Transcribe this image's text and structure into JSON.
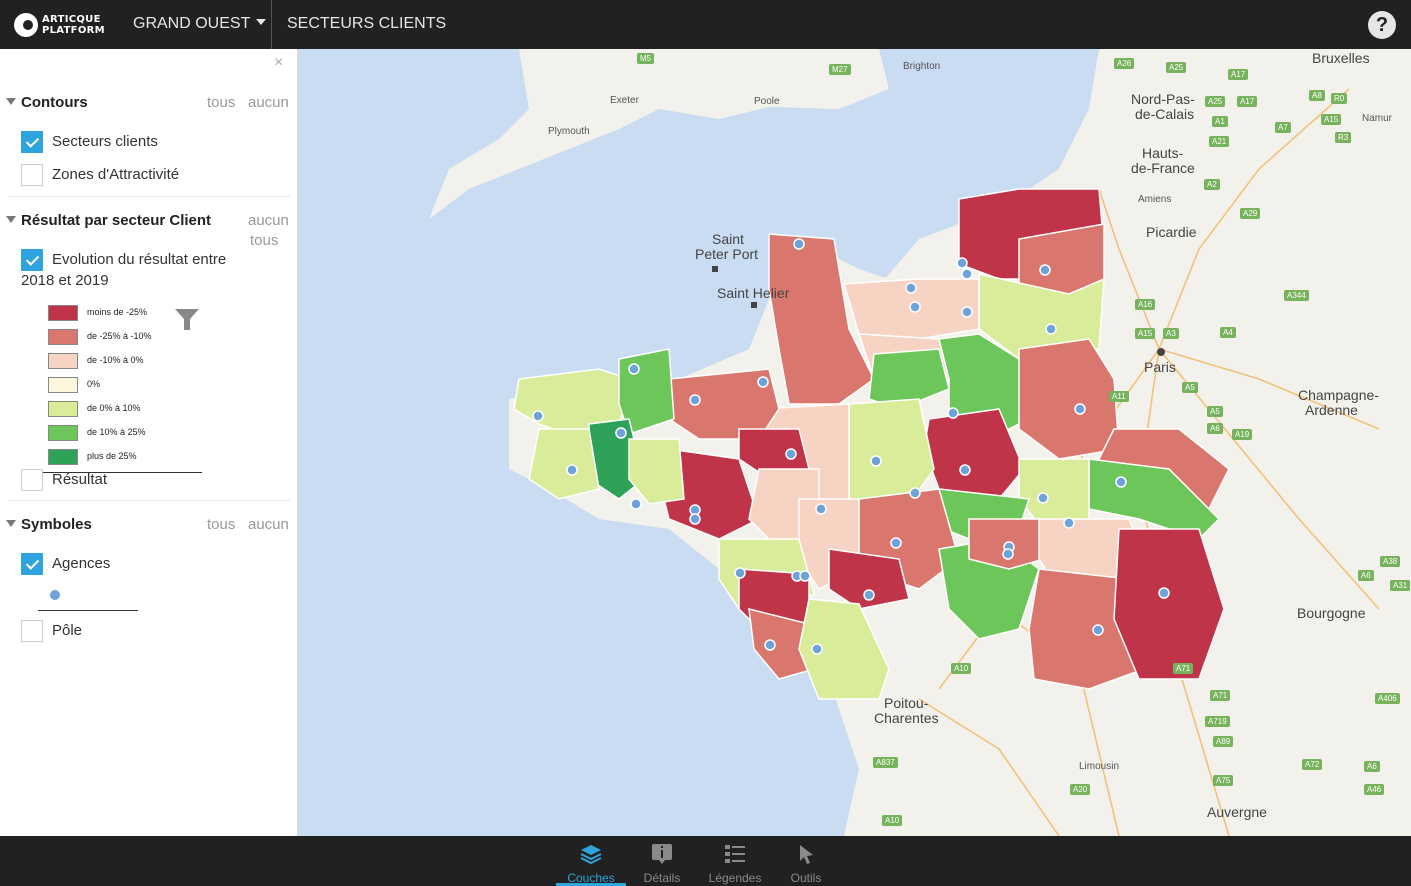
{
  "app": {
    "logo_line1": "ARTICQUE",
    "logo_line2": "PLATFORM",
    "region": "GRAND OUEST",
    "title": "SECTEURS CLIENTS",
    "help_label": "?"
  },
  "sidebar": {
    "close_label": "×",
    "contours": {
      "title": "Contours",
      "all_label": "tous",
      "none_label": "aucun",
      "items": [
        {
          "label": "Secteurs clients",
          "checked": true
        },
        {
          "label": "Zones d'Attractivité",
          "checked": false
        }
      ]
    },
    "resultat": {
      "title": "Résultat par secteur Client",
      "none_label": "aucun",
      "all_label": "tous",
      "layer_label_line1": "Evolution du résultat entre",
      "layer_label_line2": "2018 et 2019",
      "legend": [
        {
          "label": "moins de -25%",
          "color": "#c0344a"
        },
        {
          "label": "de -25% à -10%",
          "color": "#d9766d"
        },
        {
          "label": "de -10% à 0%",
          "color": "#f6d3c3"
        },
        {
          "label": "0%",
          "color": "#fbf6dc"
        },
        {
          "label": "de 0% à 10%",
          "color": "#d9ec9a"
        },
        {
          "label": "de 10% à 25%",
          "color": "#6cc65a"
        },
        {
          "label": "plus de 25%",
          "color": "#2fa25a"
        }
      ],
      "second_item": "Résultat"
    },
    "symboles": {
      "title": "Symboles",
      "all_label": "tous",
      "none_label": "aucun",
      "items": [
        {
          "label": "Agences",
          "checked": true
        },
        {
          "label": "Pôle",
          "checked": false
        }
      ],
      "agency_color": "#6ea3d9"
    }
  },
  "map": {
    "cities": [
      "Bruxelles",
      "Nord-Pas-",
      "de-Calais",
      "Hauts-",
      "de-France",
      "Amiens",
      "Picardie",
      "Paris",
      "Champagne-",
      "Ardenne",
      "Bourgogne",
      "Limousin",
      "Auvergne",
      "Poitou-",
      "Charentes",
      "Saint",
      "Peter Port",
      "Saint Helier",
      "Exeter",
      "Poole",
      "Brighton",
      "Plymouth",
      "Namur"
    ],
    "roads": [
      "M5",
      "M27",
      "A26",
      "A25",
      "A17",
      "A25",
      "A17",
      "A8",
      "R0",
      "A1",
      "A7",
      "A15",
      "A21",
      "R3",
      "A2",
      "A29",
      "A16",
      "A15",
      "A3",
      "A4",
      "A344",
      "A11",
      "A5",
      "A5",
      "A6",
      "A19",
      "A38",
      "A6",
      "A31",
      "A10",
      "A71",
      "A406",
      "A71",
      "A719",
      "A89",
      "A837",
      "A75",
      "A72",
      "A6",
      "A20",
      "A46",
      "A10"
    ],
    "colors": {
      "sea": "#c9dcf2",
      "land": "#f3f1ec",
      "agency": "#6ea3d9"
    }
  },
  "bottom_tabs": [
    {
      "label": "Couches",
      "active": true
    },
    {
      "label": "Détails",
      "active": false
    },
    {
      "label": "Légendes",
      "active": false
    },
    {
      "label": "Outils",
      "active": false
    }
  ]
}
